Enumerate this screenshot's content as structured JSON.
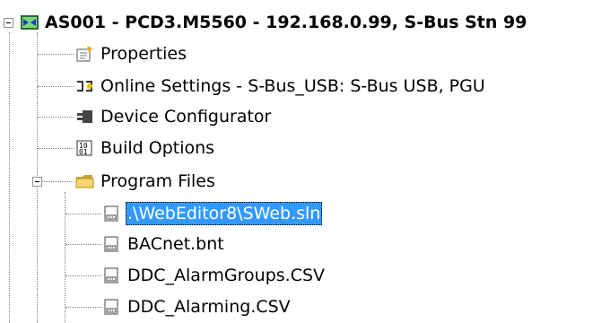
{
  "tree": {
    "root": {
      "label": "AS001 - PCD3.M5560 - 192.168.0.99, S-Bus Stn 99",
      "icon": "device-station-icon",
      "expanded": true
    },
    "children": [
      {
        "label": "Properties",
        "icon": "properties-icon"
      },
      {
        "label": "Online Settings - S-Bus_USB: S-Bus USB, PGU",
        "icon": "online-settings-icon"
      },
      {
        "label": "Device Configurator",
        "icon": "device-configurator-icon"
      },
      {
        "label": "Build Options",
        "icon": "build-options-icon"
      },
      {
        "label": "Program Files",
        "icon": "folder-icon",
        "expanded": true,
        "children": [
          {
            "label": ".\\WebEditor8\\SWeb.sln",
            "icon": "file-icon",
            "selected": true
          },
          {
            "label": "BACnet.bnt",
            "icon": "file-icon"
          },
          {
            "label": "DDC_AlarmGroups.CSV",
            "icon": "file-icon"
          },
          {
            "label": "DDC_Alarming.CSV",
            "icon": "file-icon"
          }
        ]
      }
    ]
  },
  "colors": {
    "selection": "#3399ff",
    "connector": "#7f7f7f",
    "folder": "#f5d76e"
  }
}
